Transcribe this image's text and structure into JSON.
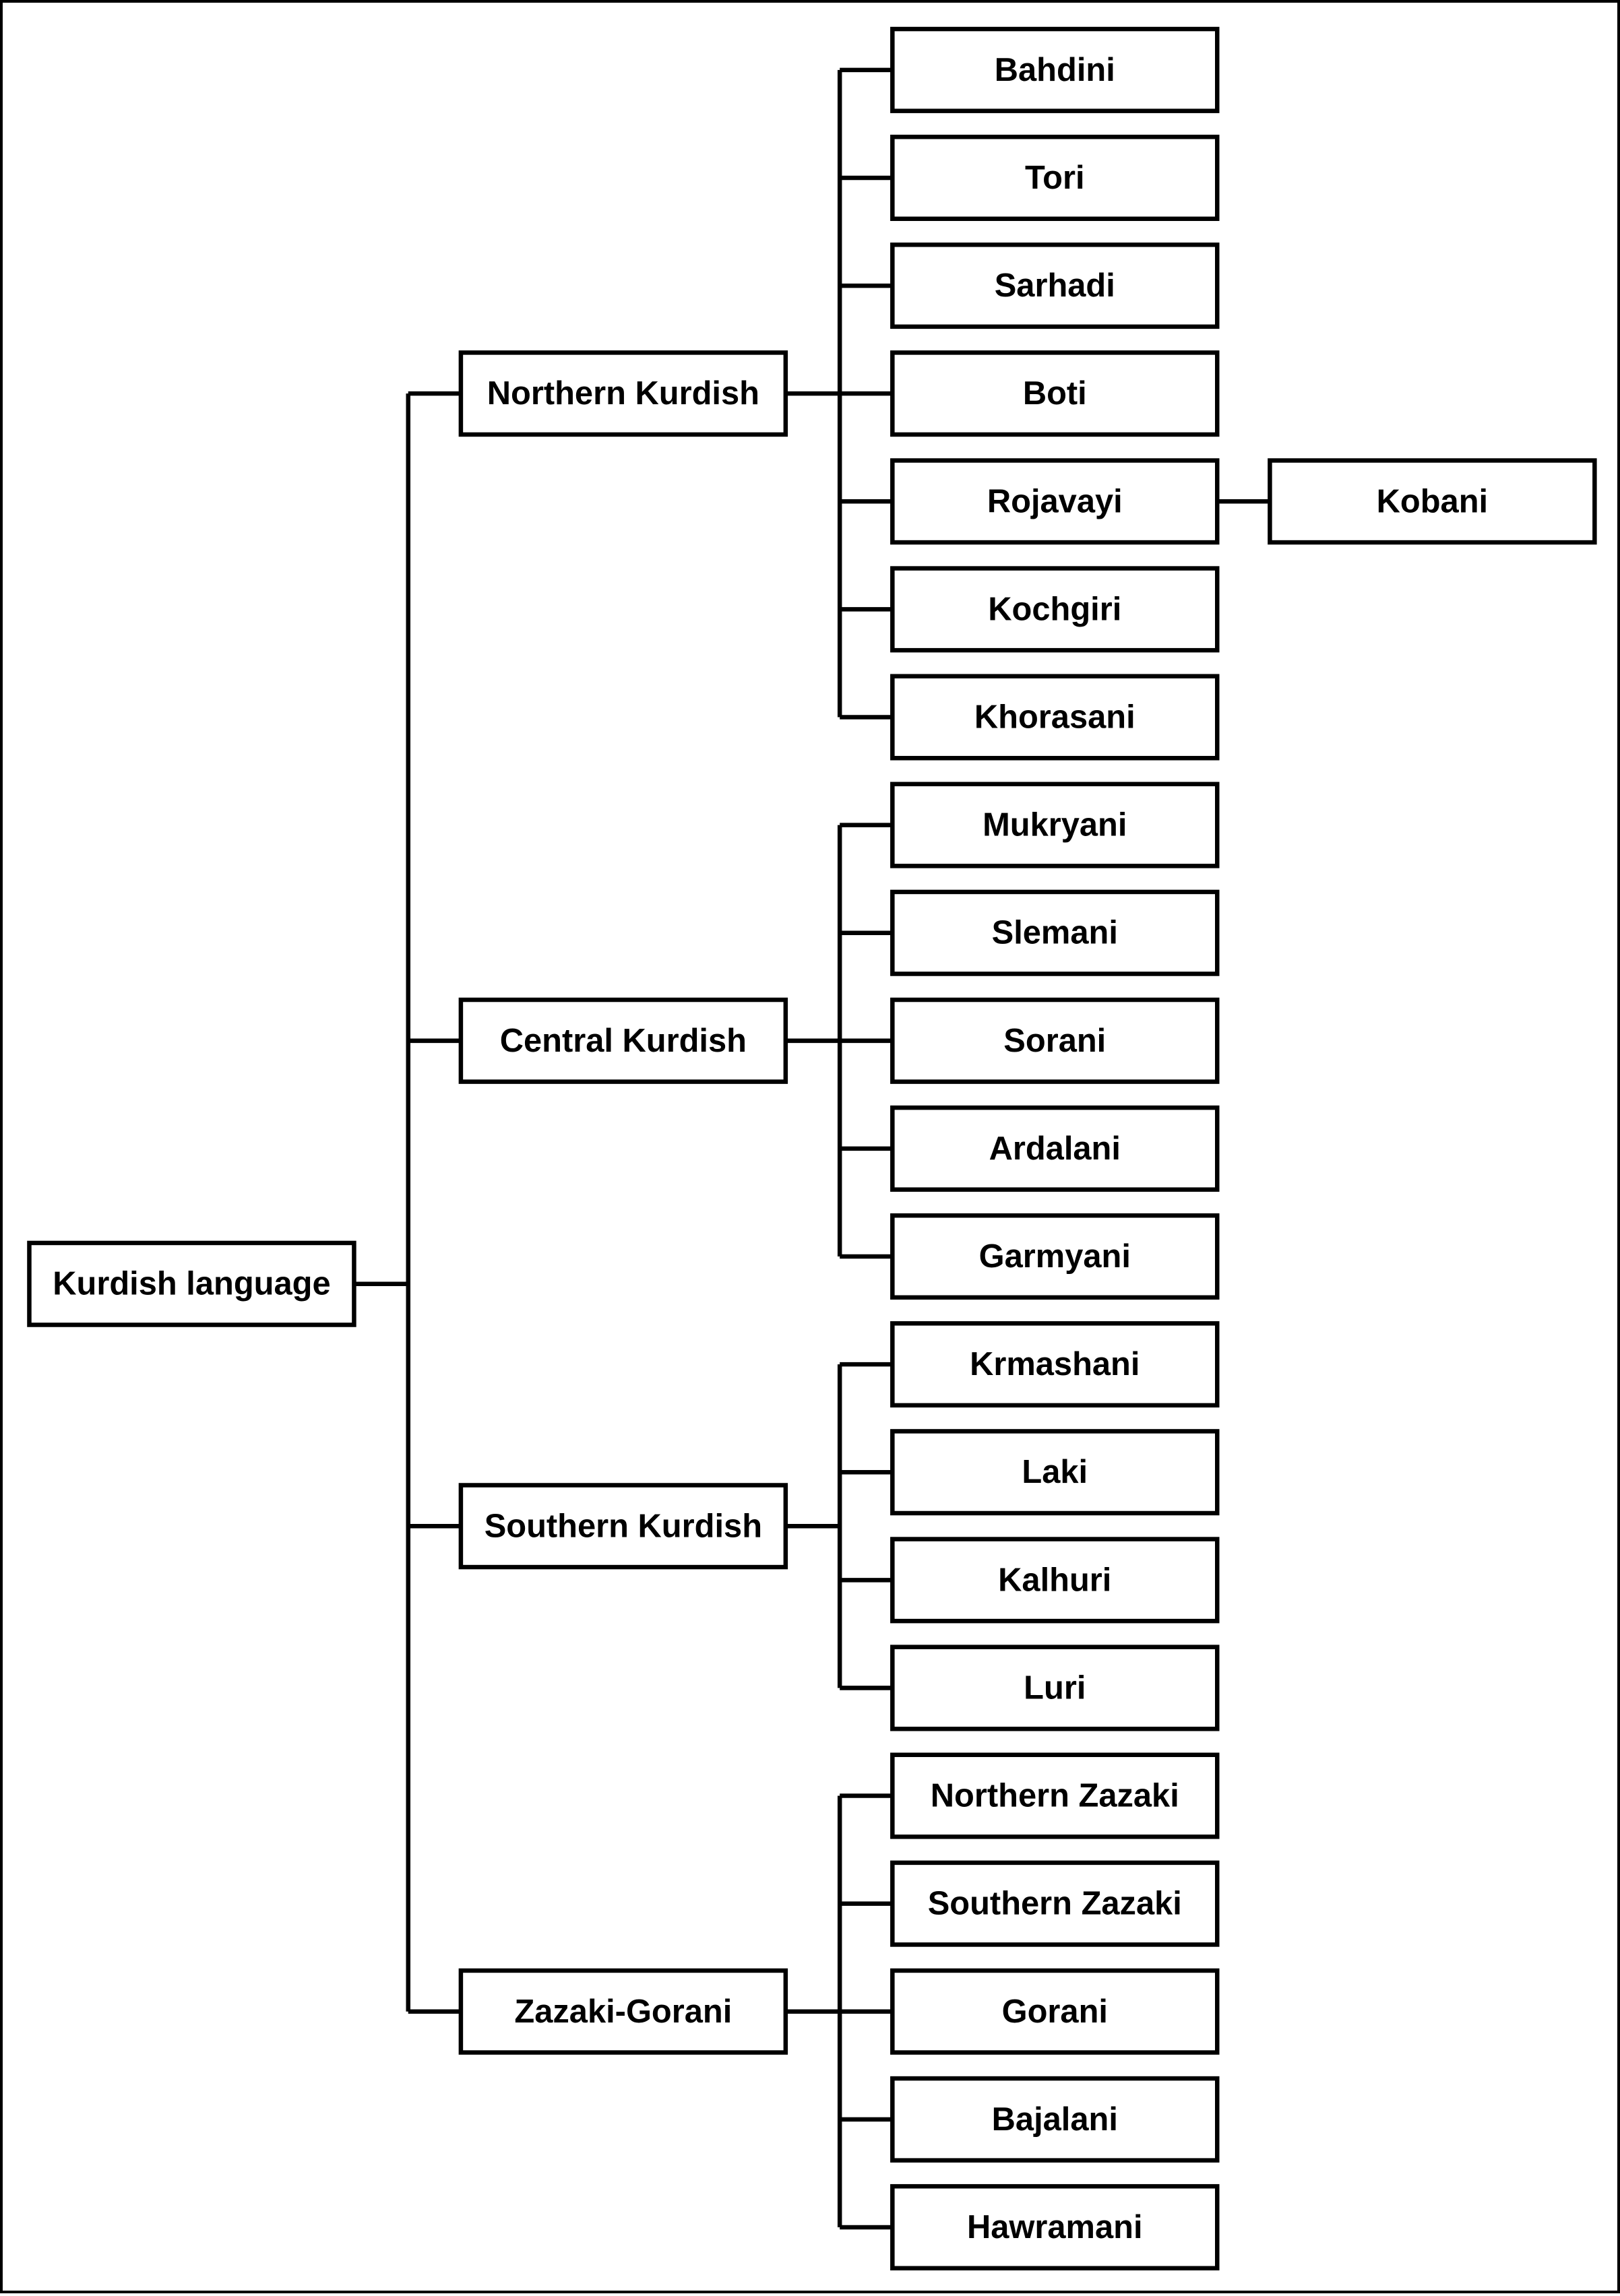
{
  "diagram": {
    "type": "tree",
    "orientation": "left-to-right",
    "colors": {
      "box_border": "#000000",
      "box_fill": "#ffffff",
      "line": "#000000",
      "text": "#000000"
    },
    "root": {
      "label": "Kurdish language",
      "children": [
        {
          "label": "Northern Kurdish",
          "children": [
            {
              "label": "Bahdini"
            },
            {
              "label": "Tori"
            },
            {
              "label": "Sarhadi"
            },
            {
              "label": "Boti"
            },
            {
              "label": "Rojavayi",
              "children": [
                {
                  "label": "Kobani"
                }
              ]
            },
            {
              "label": "Kochgiri"
            },
            {
              "label": "Khorasani"
            }
          ]
        },
        {
          "label": "Central Kurdish",
          "children": [
            {
              "label": "Mukryani"
            },
            {
              "label": "Slemani"
            },
            {
              "label": "Sorani"
            },
            {
              "label": "Ardalani"
            },
            {
              "label": "Garmyani"
            }
          ]
        },
        {
          "label": "Southern Kurdish",
          "children": [
            {
              "label": "Krmashani"
            },
            {
              "label": "Laki"
            },
            {
              "label": "Kalhuri"
            },
            {
              "label": "Luri"
            }
          ]
        },
        {
          "label": "Zazaki-Gorani",
          "children": [
            {
              "label": "Northern Zazaki"
            },
            {
              "label": "Southern Zazaki"
            },
            {
              "label": "Gorani"
            },
            {
              "label": "Bajalani"
            },
            {
              "label": "Hawramani"
            }
          ]
        }
      ]
    }
  }
}
